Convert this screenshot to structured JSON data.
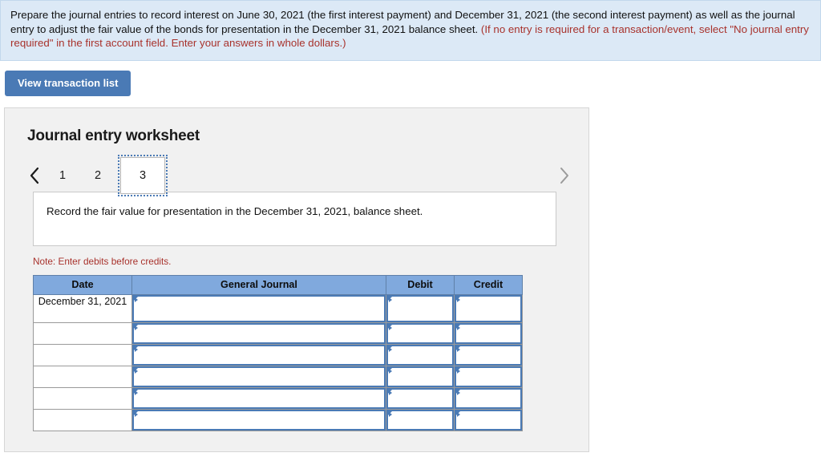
{
  "instruction": {
    "paragraph_plain_1": "Prepare the journal entries to record interest on June 30, 2021 (the first interest payment) and December 31, 2021 (the second interest payment) as well as the journal entry to adjust the fair value of the bonds for presentation in the December 31, 2021 balance sheet. ",
    "paragraph_red": "(If no entry is required for a transaction/event, select \"No journal entry required\" in the first account field. Enter your answers in whole dollars.)",
    "banner_bg": "#dce9f6",
    "red_color": "#a8322c"
  },
  "toolbar": {
    "view_transaction_label": "View transaction list",
    "button_color": "#4a7ab5"
  },
  "worksheet": {
    "title": "Journal entry worksheet",
    "pager": {
      "prev_icon": "chevron-left-icon",
      "next_icon": "chevron-right-icon",
      "tabs": [
        {
          "label": "1",
          "selected": false
        },
        {
          "label": "2",
          "selected": false
        },
        {
          "label": "3",
          "selected": true
        }
      ]
    },
    "description": "Record the fair value for presentation in the December 31, 2021, balance sheet.",
    "note": "Note: Enter debits before credits.",
    "table": {
      "headers": [
        "Date",
        "General Journal",
        "Debit",
        "Credit"
      ],
      "header_color": "#80a9dd",
      "rows": [
        {
          "date": "December 31, 2021",
          "general_journal": "",
          "debit": "",
          "credit": ""
        },
        {
          "date": "",
          "general_journal": "",
          "debit": "",
          "credit": ""
        },
        {
          "date": "",
          "general_journal": "",
          "debit": "",
          "credit": ""
        },
        {
          "date": "",
          "general_journal": "",
          "debit": "",
          "credit": ""
        },
        {
          "date": "",
          "general_journal": "",
          "debit": "",
          "credit": ""
        },
        {
          "date": "",
          "general_journal": "",
          "debit": "",
          "credit": ""
        }
      ]
    }
  }
}
